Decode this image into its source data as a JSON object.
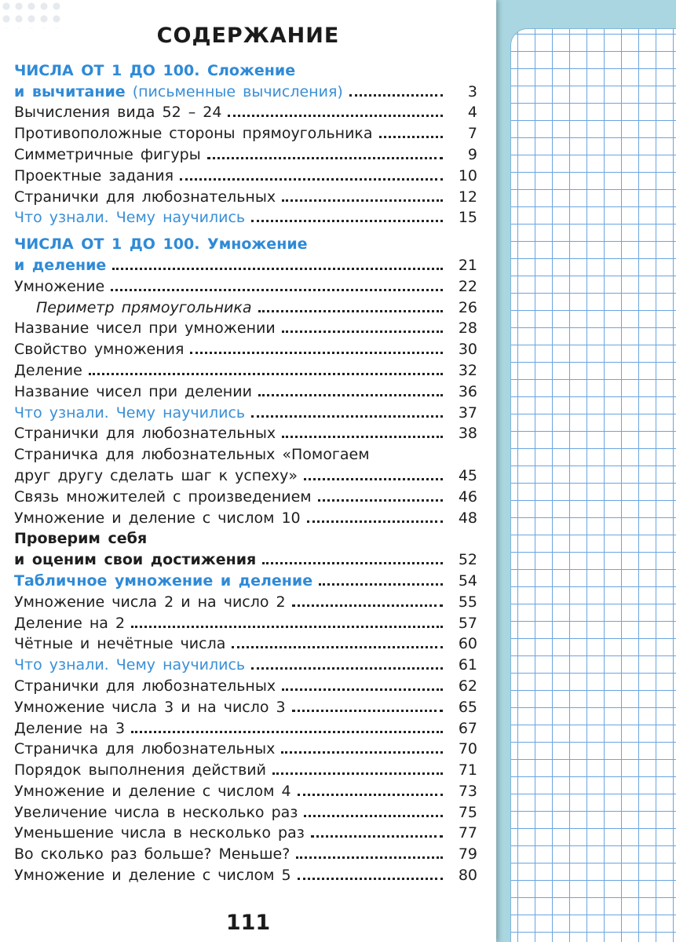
{
  "title": "СОДЕРЖАНИЕ",
  "page_number": "111",
  "toc": [
    {
      "text": "ЧИСЛА ОТ 1 ДО 100. Сложение",
      "page": "",
      "style": "blue bold noleader"
    },
    {
      "text": "и вычитание",
      "suffix": " (письменные вычисления)",
      "page": "3",
      "style": "blue bold"
    },
    {
      "text": "Вычисления вида 52 – 24",
      "page": "4",
      "style": ""
    },
    {
      "text": "Противоположные стороны прямоугольника",
      "page": "7",
      "style": ""
    },
    {
      "text": "Симметричные фигуры",
      "page": "9",
      "style": ""
    },
    {
      "text": "Проектные задания",
      "page": "10",
      "style": ""
    },
    {
      "text": "Странички для любознательных",
      "page": "12",
      "style": ""
    },
    {
      "text": "Что узнали. Чему научились",
      "page": "15",
      "style": "blue"
    },
    {
      "gap": true
    },
    {
      "text": "ЧИСЛА ОТ 1 ДО 100. Умножение",
      "page": "",
      "style": "blue bold noleader"
    },
    {
      "text": "и деление",
      "page": "21",
      "style": "blue bold"
    },
    {
      "text": "Умножение",
      "page": "22",
      "style": ""
    },
    {
      "text": "Периметр прямоугольника",
      "page": "26",
      "style": "italic"
    },
    {
      "text": "Название чисел при умножении",
      "page": "28",
      "style": ""
    },
    {
      "text": "Свойство умножения",
      "page": "30",
      "style": ""
    },
    {
      "text": "Деление",
      "page": "32",
      "style": ""
    },
    {
      "text": "Название чисел при делении",
      "page": "36",
      "style": ""
    },
    {
      "text": "Что узнали. Чему научились",
      "page": "37",
      "style": "blue"
    },
    {
      "text": "Странички для любознательных",
      "page": "38",
      "style": ""
    },
    {
      "text": "Страничка для любознательных «Помогаем",
      "page": "",
      "style": "noleader"
    },
    {
      "text": "друг другу сделать шаг к успеху»",
      "page": "45",
      "style": ""
    },
    {
      "text": "Связь множителей с произведением",
      "page": "46",
      "style": ""
    },
    {
      "text": "Умножение и деление с числом 10",
      "page": "48",
      "style": ""
    },
    {
      "text": "Проверим себя",
      "page": "",
      "style": "bold noleader"
    },
    {
      "text": "и оценим свои достижения",
      "page": "52",
      "style": "bold"
    },
    {
      "text": "Табличное умножение и деление",
      "page": "54",
      "style": "blue bold"
    },
    {
      "text": "Умножение числа 2 и на число 2",
      "page": "55",
      "style": ""
    },
    {
      "text": "Деление на 2",
      "page": "57",
      "style": ""
    },
    {
      "text": "Чётные и нечётные числа",
      "page": "60",
      "style": ""
    },
    {
      "text": "Что узнали. Чему научились",
      "page": "61",
      "style": "blue"
    },
    {
      "text": "Странички для любознательных",
      "page": "62",
      "style": ""
    },
    {
      "text": "Умножение числа 3 и на число 3",
      "page": "65",
      "style": ""
    },
    {
      "text": "Деление на 3",
      "page": "67",
      "style": ""
    },
    {
      "text": "Страничка для любознательных",
      "page": "70",
      "style": ""
    },
    {
      "text": "Порядок выполнения действий",
      "page": "71",
      "style": ""
    },
    {
      "text": "Умножение и деление с числом 4",
      "page": "73",
      "style": ""
    },
    {
      "text": "Увеличение числа в несколько раз",
      "page": "75",
      "style": ""
    },
    {
      "text": "Уменьшение числа в несколько раз",
      "page": "77",
      "style": ""
    },
    {
      "text": "Во сколько раз больше? Меньше?",
      "page": "79",
      "style": ""
    },
    {
      "text": "Умножение и деление с числом 5",
      "page": "80",
      "style": ""
    }
  ]
}
